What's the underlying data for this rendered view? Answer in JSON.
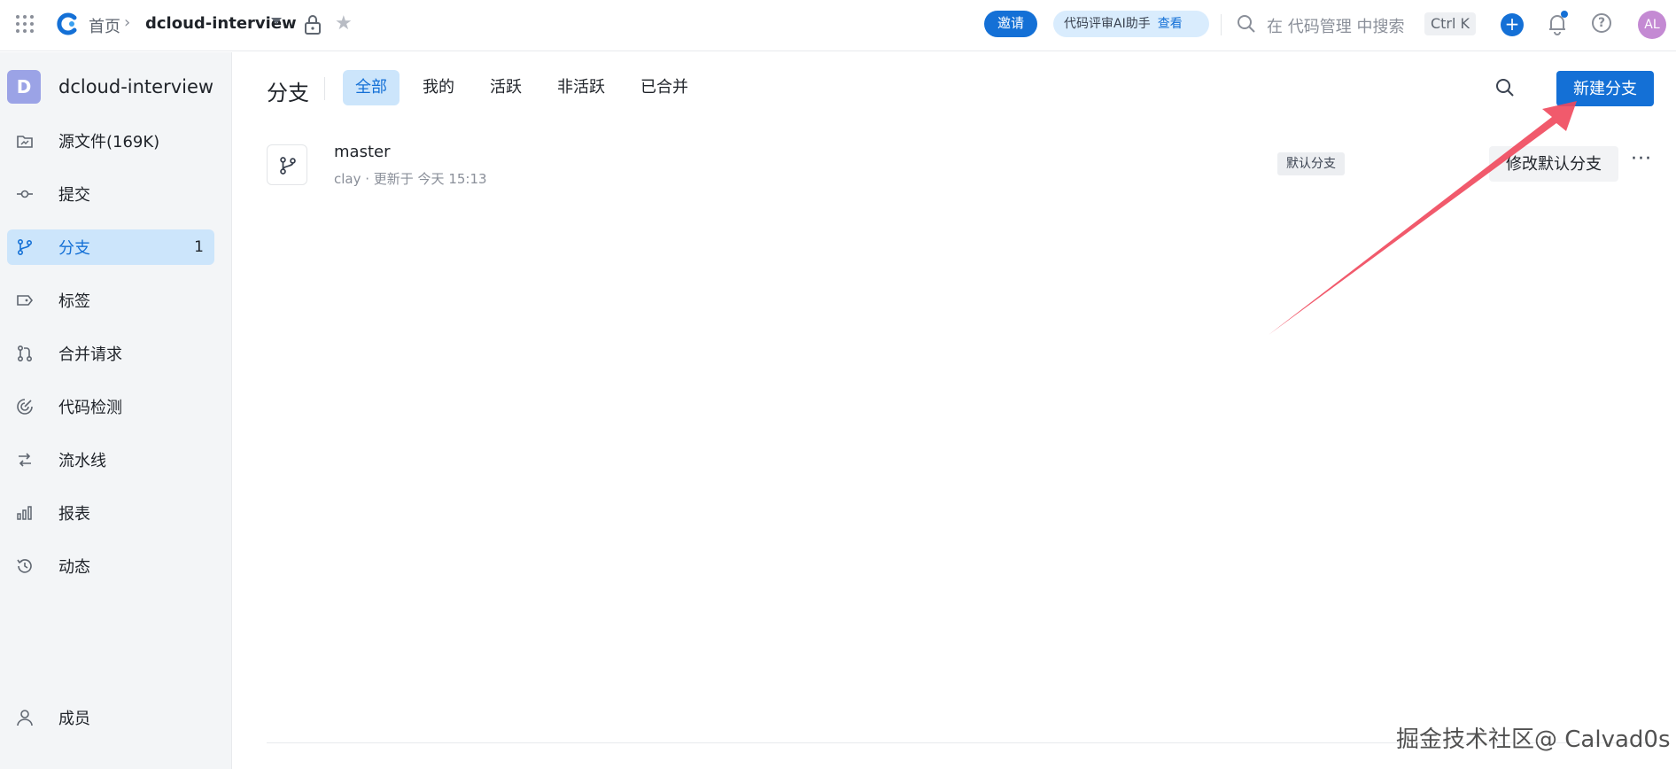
{
  "topbar": {
    "home": "首页",
    "repo": "dcloud-interview",
    "invite": "邀请",
    "ai_assistant": "代码评审AI助手",
    "ai_view": "查看",
    "search_placeholder": "在 代码管理 中搜索",
    "shortcut": "Ctrl K",
    "avatar": "AL"
  },
  "sidebar": {
    "repo_initial": "D",
    "repo_name": "dcloud-interview",
    "items": [
      {
        "label": "源文件(169K)",
        "icon": "source-files-icon"
      },
      {
        "label": "提交",
        "icon": "commit-icon"
      },
      {
        "label": "分支",
        "icon": "branch-icon",
        "count": "1",
        "active": true
      },
      {
        "label": "标签",
        "icon": "tag-icon"
      },
      {
        "label": "合并请求",
        "icon": "merge-request-icon"
      },
      {
        "label": "代码检测",
        "icon": "code-scan-icon"
      },
      {
        "label": "流水线",
        "icon": "pipeline-icon"
      },
      {
        "label": "报表",
        "icon": "report-icon"
      },
      {
        "label": "动态",
        "icon": "history-icon"
      }
    ],
    "member": "成员"
  },
  "main": {
    "title": "分支",
    "filters": [
      "全部",
      "我的",
      "活跃",
      "非活跃",
      "已合并"
    ],
    "active_filter": "全部",
    "new_branch": "新建分支",
    "branch": {
      "name": "master",
      "meta": "clay · 更新于 今天 15:13",
      "badge": "默认分支",
      "action": "修改默认分支",
      "more": "···"
    }
  },
  "watermark": "掘金技术社区@ Calvad0s",
  "colors": {
    "primary": "#1470d6",
    "active_bg": "#cce5fb",
    "arrow": "#f0485c"
  }
}
